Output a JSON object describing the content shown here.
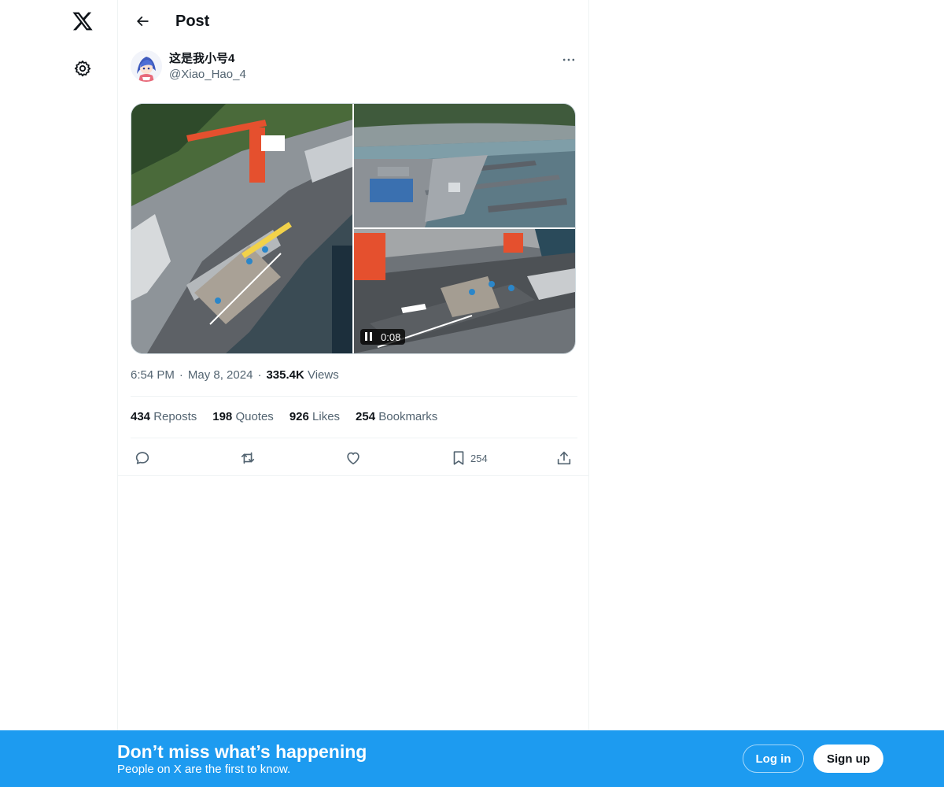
{
  "nav": {
    "logo_icon": "x-logo-icon",
    "settings_icon": "gear-icon"
  },
  "header": {
    "title": "Post",
    "back_icon": "arrow-left-icon"
  },
  "post": {
    "display_name": "这是我小号4",
    "handle": "@Xiao_Hao_4",
    "more_icon": "more-horizontal-icon",
    "media": {
      "video_duration": "0:08",
      "pause_icon": "pause-icon"
    },
    "time": "6:54 PM",
    "date": "May 8, 2024",
    "separator": "·",
    "views_count": "335.4K",
    "views_label": "Views",
    "stats": {
      "reposts_count": "434",
      "reposts_label": "Reposts",
      "quotes_count": "198",
      "quotes_label": "Quotes",
      "likes_count": "926",
      "likes_label": "Likes",
      "bookmarks_count": "254",
      "bookmarks_label": "Bookmarks"
    },
    "actions": {
      "bookmark_count": "254"
    }
  },
  "banner": {
    "title": "Don’t miss what’s happening",
    "subtitle": "People on X are the first to know.",
    "login_label": "Log in",
    "signup_label": "Sign up"
  },
  "colors": {
    "accent": "#1d9bf0",
    "text_primary": "#0f1419",
    "text_secondary": "#536471",
    "border": "#eff3f4"
  }
}
